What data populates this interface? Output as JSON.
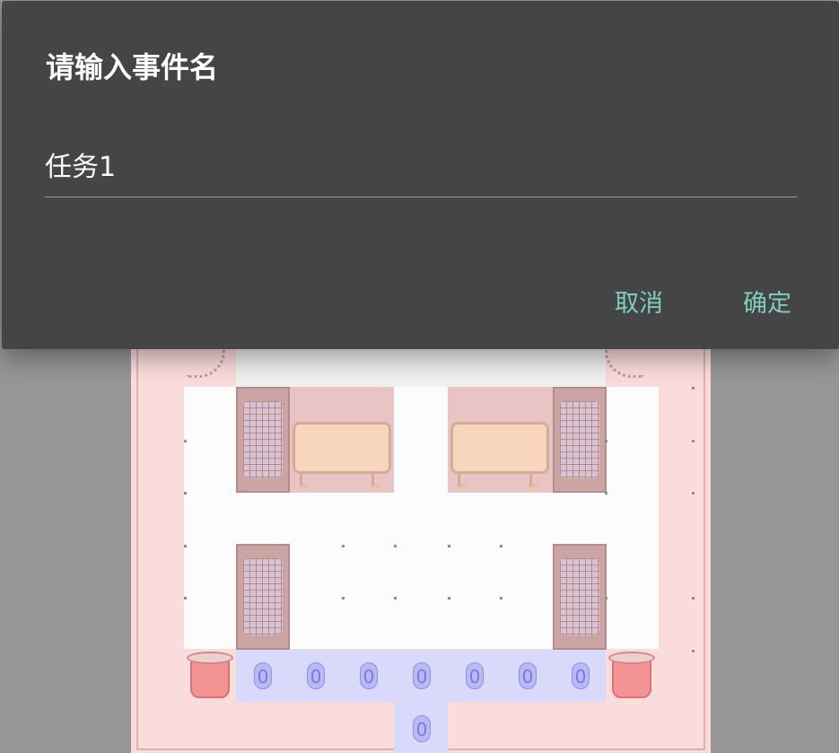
{
  "dialog": {
    "title": "请输入事件名",
    "input_value": "任务1",
    "cancel_label": "取消",
    "confirm_label": "确定"
  },
  "map": {
    "counter_label": "0"
  },
  "colors": {
    "dialog_bg": "#454545",
    "accent": "#7ecdc1",
    "backdrop": "#969696"
  }
}
